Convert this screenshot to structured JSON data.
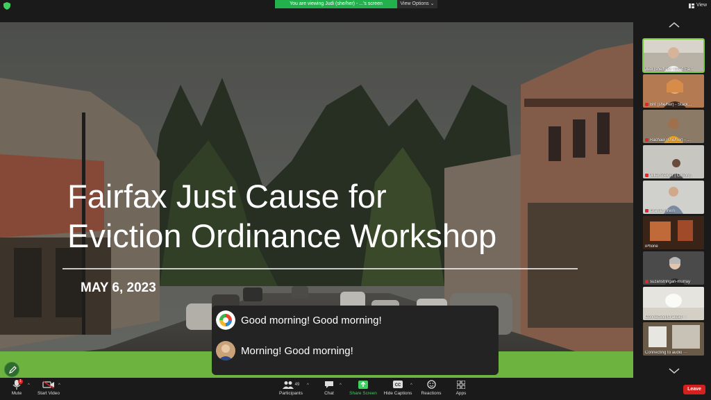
{
  "topbar": {
    "banner_text": "You are viewing Judi (she/her) - ...'s screen",
    "view_options_label": "View Options",
    "view_label": "View"
  },
  "slide": {
    "title_line1": "Fairfax Just Cause for",
    "title_line2": "Eviction Ordinance Workshop",
    "date": "MAY 6, 2023"
  },
  "chat": {
    "messages": [
      {
        "text": "Good morning! Good morning!"
      },
      {
        "text": "Morning! Good morning!"
      }
    ]
  },
  "gallery": {
    "participants": [
      {
        "name": "Judi (she/her) - Lead Fa...",
        "muted": false,
        "active": true
      },
      {
        "name": "Brit (she/her) - Stack...",
        "muted": true
      },
      {
        "name": "Rachael (she/her) - ...",
        "muted": true
      },
      {
        "name": "Jillian Zeiger | County...",
        "muted": true
      },
      {
        "name": "Graham Irwin",
        "muted": true
      },
      {
        "name": "iPhone",
        "muted": false
      },
      {
        "name": "suzanstringari-murray",
        "muted": true
      },
      {
        "name": "Connecting to audio",
        "muted": false
      },
      {
        "name": "Connecting to audio",
        "muted": false
      }
    ]
  },
  "toolbar": {
    "mute_label": "Mute",
    "mute_badge": "1",
    "start_video_label": "Start Video",
    "participants_label": "Participants",
    "participants_count": "49",
    "chat_label": "Chat",
    "share_screen_label": "Share Screen",
    "captions_label": "Hide Captions",
    "reactions_label": "Reactions",
    "apps_label": "Apps",
    "leave_label": "Leave"
  },
  "colors": {
    "share_green": "#22b14c",
    "leave_red": "#d4201f",
    "slide_band": "#6db33f",
    "active_tile": "#7ac943"
  }
}
